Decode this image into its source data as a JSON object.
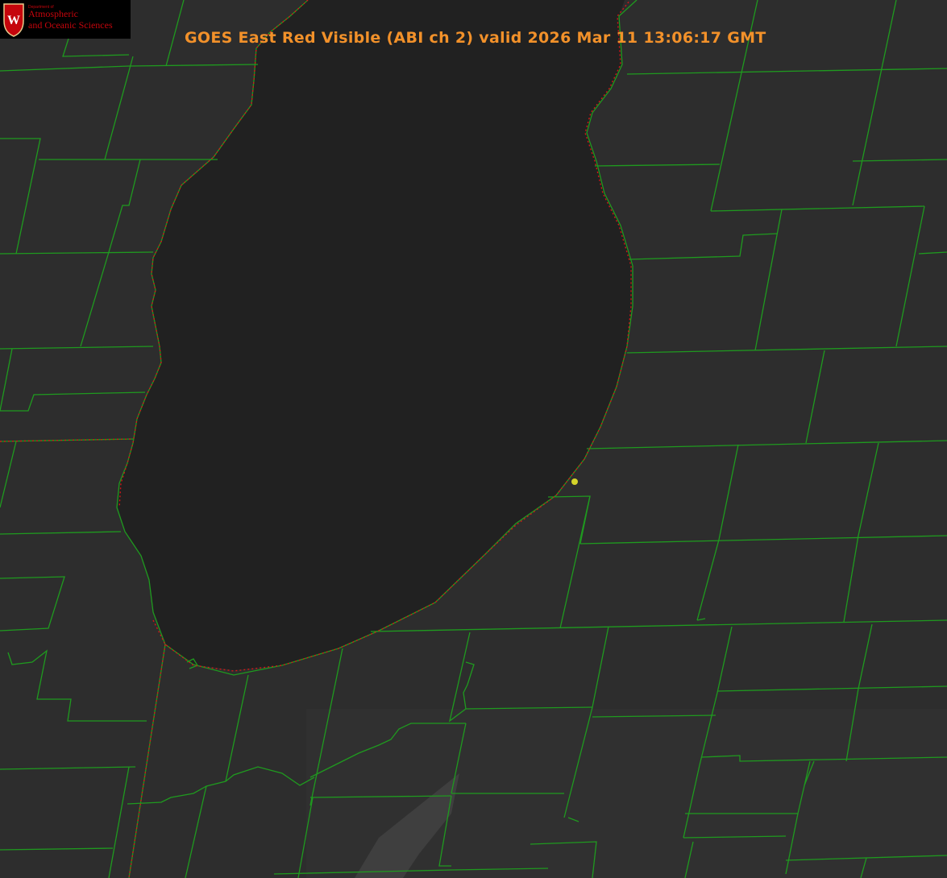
{
  "title": "GOES East Red Visible (ABI ch 2) valid 2026 Mar 11 13:06:17 GMT",
  "logo": {
    "department": "Department of",
    "line1": "Atmospheric",
    "line2": "and Oceanic Sciences",
    "crest_letter": "W"
  },
  "colors": {
    "background": "#2b2b2b",
    "lake": "#232323",
    "county_lines": "#1f9a1f",
    "state_border": "#d01818",
    "title": "#f2912a",
    "marker": "#d4d42a"
  },
  "map_features": {
    "lake": "Lake Michigan",
    "marker": "observation site (yellow dot)"
  }
}
